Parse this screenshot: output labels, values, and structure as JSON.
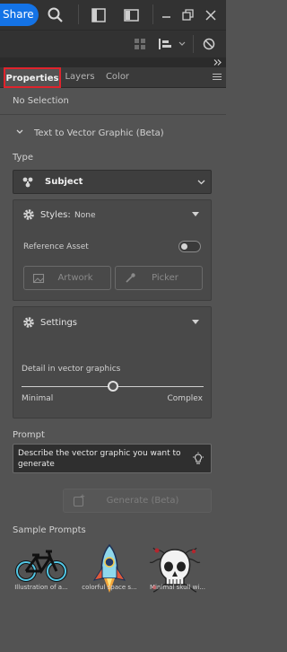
{
  "topbar": {
    "share_label": "Share"
  },
  "tabs": [
    {
      "label": "Properties",
      "active": true
    },
    {
      "label": "Layers",
      "active": false
    },
    {
      "label": "Color",
      "active": false
    }
  ],
  "selection_status": "No Selection",
  "section": {
    "title": "Text to Vector Graphic (Beta)"
  },
  "type": {
    "label": "Type",
    "selected": "Subject"
  },
  "styles": {
    "label": "Styles:",
    "value": "None"
  },
  "reference_asset": {
    "label": "Reference Asset",
    "toggle_on": false
  },
  "buttons": {
    "artwork": "Artwork",
    "picker": "Picker",
    "generate": "Generate (Beta)"
  },
  "settings": {
    "label": "Settings",
    "detail_label": "Detail in vector graphics",
    "min_label": "Minimal",
    "max_label": "Complex",
    "detail_level": 0.5
  },
  "prompt": {
    "label": "Prompt",
    "placeholder": "Describe the vector graphic you want to generate"
  },
  "sample_prompts": {
    "label": "Sample Prompts",
    "items": [
      {
        "caption": "Illustration of a...",
        "icon": "bicycle-icon"
      },
      {
        "caption": "colorful space s...",
        "icon": "rocket-icon"
      },
      {
        "caption": "Minimal skull wi...",
        "icon": "skull-icon"
      }
    ]
  },
  "colors": {
    "accent": "#1473e6",
    "highlight": "#e0232c",
    "panel": "#535353"
  }
}
